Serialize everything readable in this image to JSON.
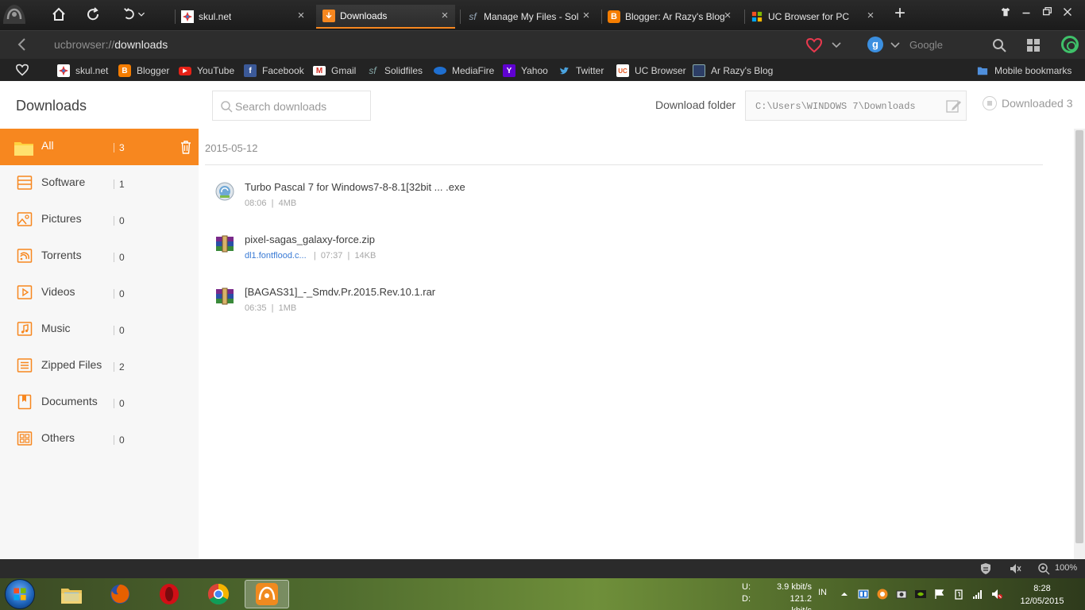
{
  "browser": {
    "tabs": [
      {
        "label": "skul.net",
        "icon": "skulnet-favicon"
      },
      {
        "label": "Downloads",
        "icon": "download-favicon",
        "active": true
      },
      {
        "label": "Manage My Files - Solid",
        "icon": "solidfiles-favicon"
      },
      {
        "label": "Blogger: Ar Razy's Blog",
        "icon": "blogger-favicon"
      },
      {
        "label": "UC Browser for PC",
        "icon": "ucbrowser-favicon"
      }
    ],
    "url_prefix": "ucbrowser://",
    "url_path": "downloads",
    "search_placeholder": "Google",
    "search_engine_letter": "g"
  },
  "bookmarks": [
    {
      "label": "skul.net",
      "icon": "skulnet-favicon"
    },
    {
      "label": "Blogger",
      "icon": "blogger-favicon"
    },
    {
      "label": "YouTube",
      "icon": "youtube-favicon"
    },
    {
      "label": "Facebook",
      "icon": "facebook-favicon"
    },
    {
      "label": "Gmail",
      "icon": "gmail-favicon"
    },
    {
      "label": "Solidfiles",
      "icon": "solidfiles-favicon"
    },
    {
      "label": "MediaFire",
      "icon": "mediafire-favicon"
    },
    {
      "label": "Yahoo",
      "icon": "yahoo-favicon"
    },
    {
      "label": "Twitter",
      "icon": "twitter-favicon"
    },
    {
      "label": "UC Browser",
      "icon": "ucbrowser-favicon"
    },
    {
      "label": "Ar Razy's Blog",
      "icon": "blog-favicon"
    },
    {
      "label": "Mobile bookmarks",
      "icon": "folder-icon"
    }
  ],
  "downloads_page": {
    "title": "Downloads",
    "search_placeholder": "Search downloads",
    "folder_label": "Download folder",
    "folder_path": "C:\\Users\\WINDOWS 7\\Downloads",
    "downloaded_text": "Downloaded 3"
  },
  "categories": [
    {
      "label": "All",
      "count": "3",
      "icon": "folder-icon"
    },
    {
      "label": "Software",
      "count": "1",
      "icon": "software-icon"
    },
    {
      "label": "Pictures",
      "count": "0",
      "icon": "picture-icon"
    },
    {
      "label": "Torrents",
      "count": "0",
      "icon": "torrent-icon"
    },
    {
      "label": "Videos",
      "count": "0",
      "icon": "video-icon"
    },
    {
      "label": "Music",
      "count": "0",
      "icon": "music-icon"
    },
    {
      "label": "Zipped Files",
      "count": "2",
      "icon": "zip-icon"
    },
    {
      "label": "Documents",
      "count": "0",
      "icon": "document-icon"
    },
    {
      "label": "Others",
      "count": "0",
      "icon": "others-icon"
    }
  ],
  "download_groups": [
    {
      "date": "2015-05-12",
      "items": [
        {
          "name": "Turbo Pascal 7 for Windows7-8-8.1[32bit ...   .exe",
          "time": "08:06",
          "size": "4MB",
          "icon": "installer-icon"
        },
        {
          "name": "pixel-sagas_galaxy-force.zip",
          "source": "dl1.fontflood.c...",
          "time": "07:37",
          "size": "14KB",
          "icon": "winrar-icon"
        },
        {
          "name": "[BAGAS31]_-_Smdv.Pr.2015.Rev.10.1.rar",
          "time": "06:35",
          "size": "1MB",
          "icon": "winrar-icon"
        }
      ]
    }
  ],
  "statusbar": {
    "zoom": "100%"
  },
  "taskbar": {
    "apps": [
      "windows-explorer",
      "firefox",
      "opera",
      "chrome",
      "uc-browser"
    ],
    "net_upload_label": "U:",
    "net_upload_value": "3.9 kbit/s",
    "net_download_label": "D:",
    "net_download_value": "121.2 kbit/s",
    "language": "IN",
    "time": "8:28",
    "date": "12/05/2015"
  },
  "colors": {
    "accent": "#f7871f",
    "link": "#3a7bd5"
  }
}
